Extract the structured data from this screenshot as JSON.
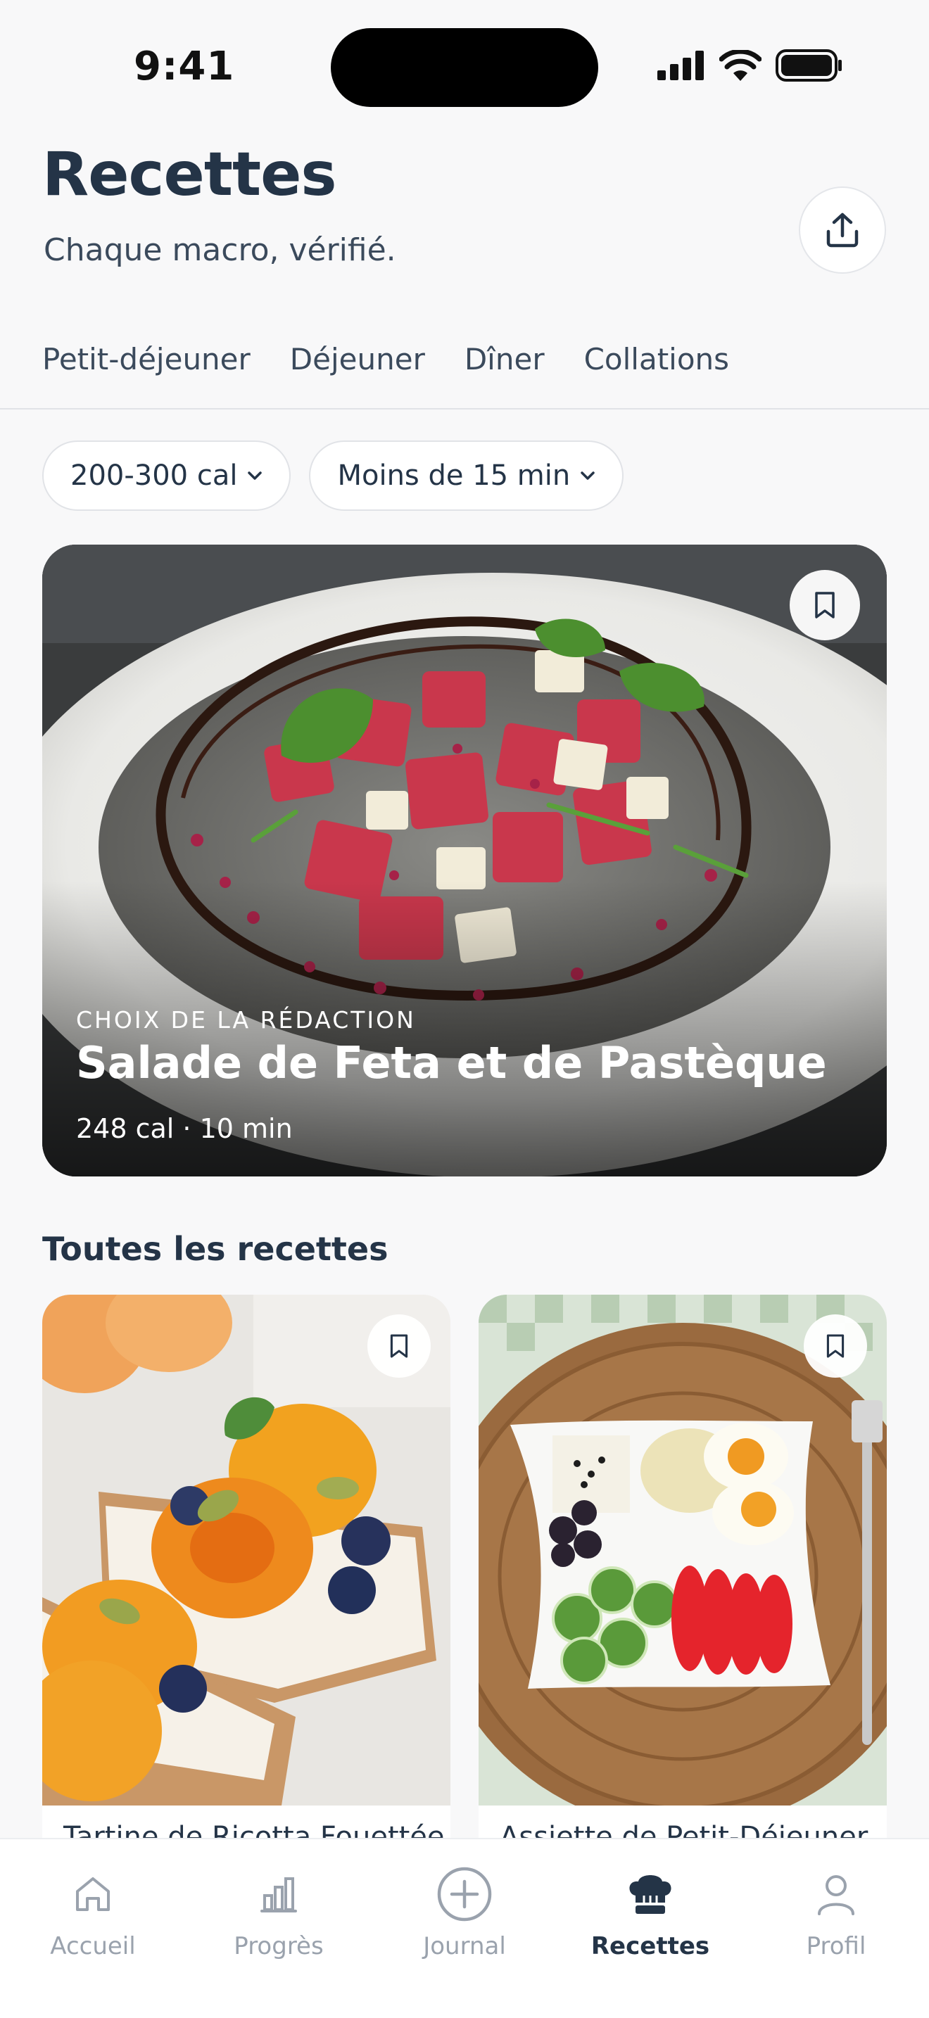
{
  "status_bar": {
    "time": "9:41"
  },
  "header": {
    "title": "Recettes",
    "subtitle": "Chaque macro, vérifié."
  },
  "tabs": [
    {
      "label": "Petit-déjeuner"
    },
    {
      "label": "Déjeuner"
    },
    {
      "label": "Dîner"
    },
    {
      "label": "Collations"
    }
  ],
  "filters": [
    {
      "label": "200-300 cal"
    },
    {
      "label": "Moins de 15 min"
    }
  ],
  "featured": {
    "eyebrow": "CHOIX DE LA RÉDACTION",
    "title": "Salade de Feta et de Pastèque",
    "meta": "248 cal · 10 min"
  },
  "section": {
    "title": "Toutes les recettes"
  },
  "recipes": [
    {
      "title": "Tartine de Ricotta Fouettée"
    },
    {
      "title": "Assiette de Petit-Déjeuner"
    }
  ],
  "nav": [
    {
      "label": "Accueil",
      "icon": "home-icon"
    },
    {
      "label": "Progrès",
      "icon": "chart-icon"
    },
    {
      "label": "Journal",
      "icon": "plus-circle-icon"
    },
    {
      "label": "Recettes",
      "icon": "chef-hat-icon",
      "active": true
    },
    {
      "label": "Profil",
      "icon": "user-icon"
    }
  ],
  "colors": {
    "text": "#243447",
    "muted": "#9aa2ad",
    "background": "#f8f8f9"
  }
}
